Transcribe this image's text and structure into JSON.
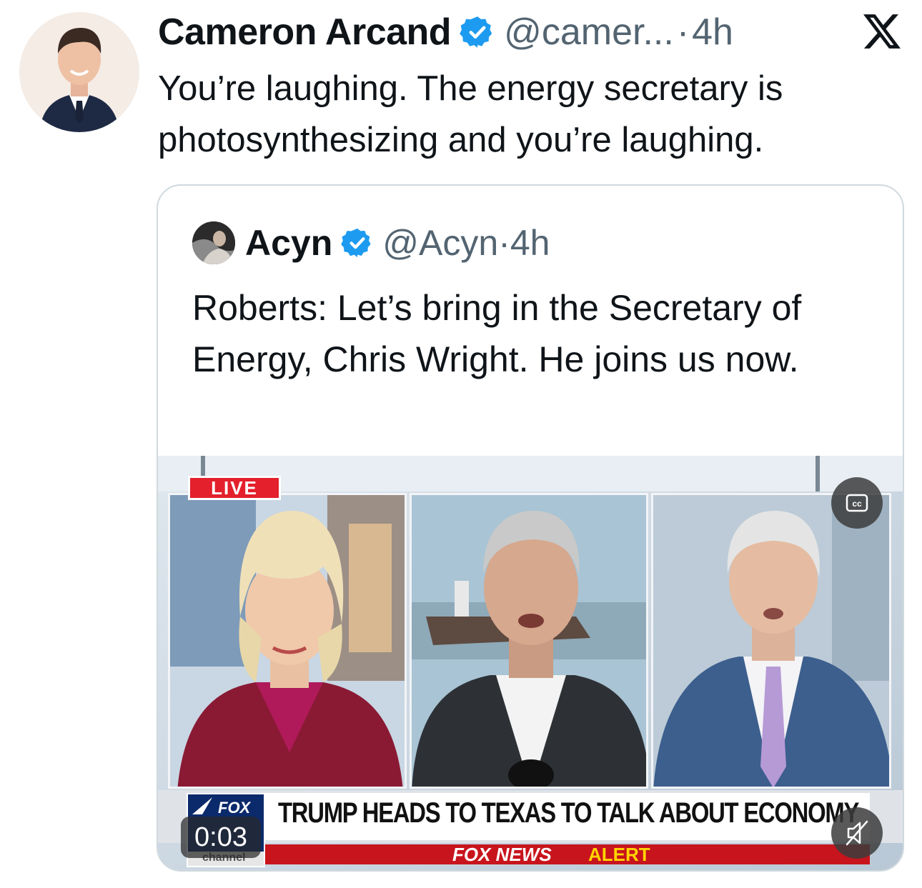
{
  "tweet": {
    "author_name": "Cameron Arcand",
    "handle": "@camer...",
    "separator": "·",
    "time": "4h",
    "text": "You’re laughing. The energy secretary is photosynthesizing and you’re laughing.",
    "verified_icon": "verified-badge-icon",
    "platform_icon": "x-logo-icon"
  },
  "quoted_tweet": {
    "author_name": "Acyn",
    "handle": "@Acyn",
    "separator": "·",
    "time": "4h",
    "text": "Roberts: Let’s bring in the Secretary of Energy, Chris Wright. He joins us now.",
    "video": {
      "live_label": "LIVE",
      "headline": "TRUMP HEADS TO TEXAS TO TALK ABOUT ECONOMY",
      "alert_prefix": "FOX NEWS",
      "alert_word": "ALERT",
      "network_logo_text": "FOX",
      "network_logo_sub": "channel",
      "elapsed_time": "0:03",
      "captions_icon": "closed-captions-icon",
      "mute_icon": "muted-speaker-icon"
    }
  },
  "colors": {
    "verified_blue": "#1d9bf0",
    "text_primary": "#0f1419",
    "text_secondary": "#536471",
    "border": "#cfd9de",
    "alert_red": "#c8141c",
    "alert_yellow": "#ffd500"
  }
}
